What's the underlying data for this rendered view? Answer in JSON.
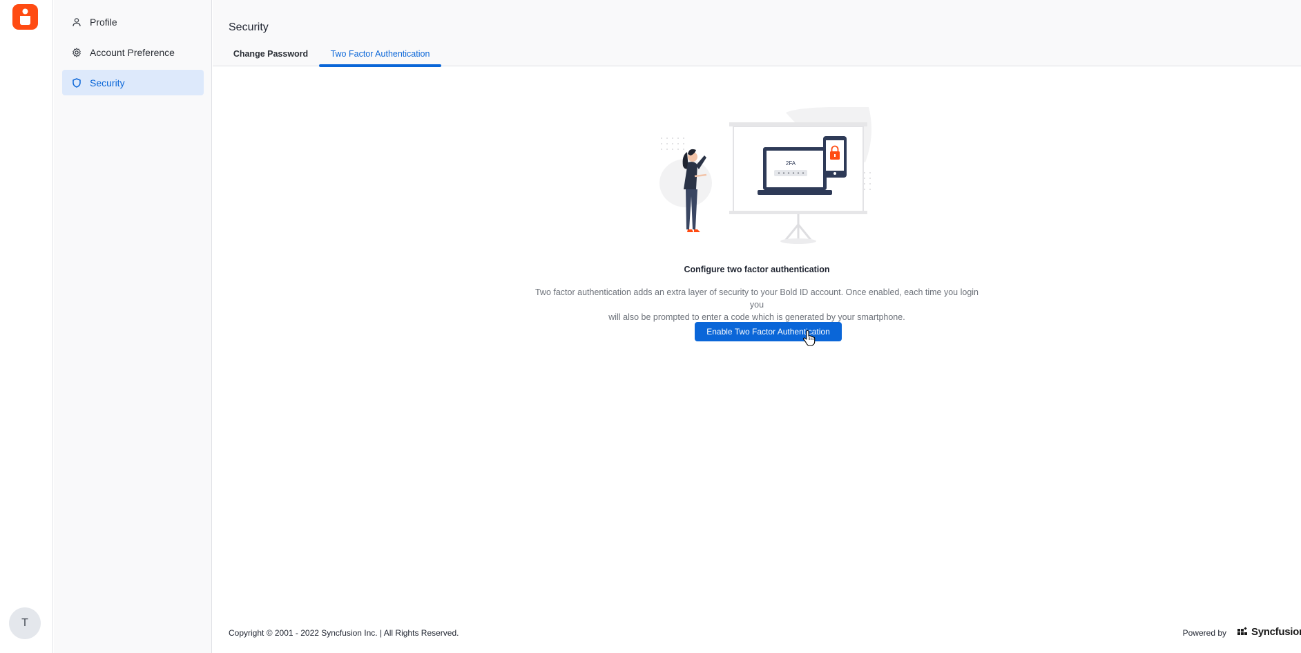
{
  "app": {
    "brand_color": "#ff4b12",
    "accent_color": "#0a66d8"
  },
  "user": {
    "avatar_initial": "T"
  },
  "sidebar": {
    "items": [
      {
        "label": "Profile",
        "icon": "user-icon",
        "active": false
      },
      {
        "label": "Account Preference",
        "icon": "gear-icon",
        "active": false
      },
      {
        "label": "Security",
        "icon": "shield-icon",
        "active": true
      }
    ]
  },
  "header": {
    "title": "Security",
    "tabs": [
      {
        "label": "Change Password",
        "active": false
      },
      {
        "label": "Two Factor Authentication",
        "active": true
      }
    ]
  },
  "main": {
    "illustration": {
      "code_label": "2FA",
      "icon": "two-factor-illustration"
    },
    "config_title": "Configure two factor authentication",
    "config_desc_line1": "Two factor authentication adds an extra layer of security to your Bold ID account. Once enabled, each time you login you",
    "config_desc_line2": "will also be prompted to enter a code which is generated by your smartphone.",
    "enable_button": "Enable Two Factor Authentication"
  },
  "footer": {
    "copyright": "Copyright © 2001 - 2022 Syncfusion Inc. | All Rights Reserved.",
    "powered_by": "Powered by",
    "brand": "Syncfusion"
  }
}
